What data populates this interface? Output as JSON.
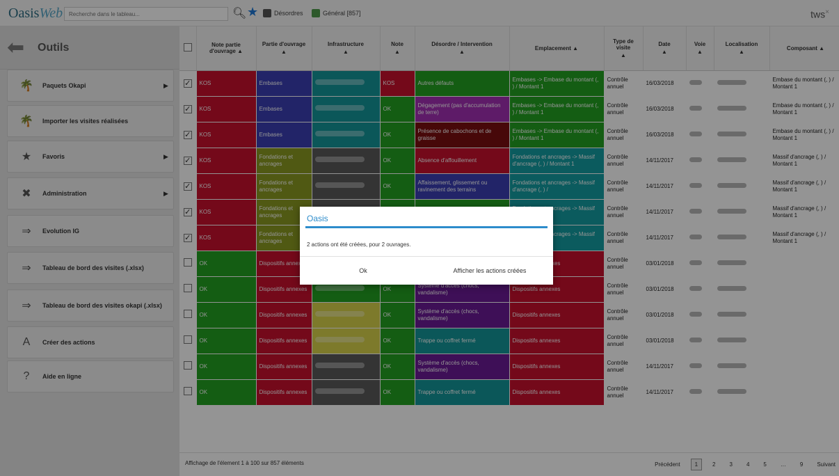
{
  "topbar": {
    "logo_main": "Oasis",
    "logo_web": "Web",
    "search_placeholder": "Recherche dans le tableau...",
    "quick_desordres": "Désordres",
    "quick_general": "Général [857]",
    "user": "tws",
    "user_close": "×"
  },
  "sidebar": {
    "title": "Outils",
    "items": [
      {
        "label": "Paquets Okapi",
        "icon": "palm-icon",
        "glyph": "🌴",
        "caret": "▶"
      },
      {
        "label": "Importer les visites réalisées",
        "icon": "palm-icon",
        "glyph": "🌴",
        "caret": ""
      },
      {
        "label": "Favoris",
        "icon": "star-icon",
        "glyph": "★",
        "caret": "▶"
      },
      {
        "label": "Administration",
        "icon": "tools-icon",
        "glyph": "✖",
        "caret": "▶"
      },
      {
        "label": "Evolution IG",
        "icon": "export-icon",
        "glyph": "⇒",
        "caret": ""
      },
      {
        "label": "Tableau de bord des visites (.xlsx)",
        "icon": "export-icon",
        "glyph": "⇒",
        "caret": ""
      },
      {
        "label": "Tableau de bord des visites okapi (.xlsx)",
        "icon": "export-icon",
        "glyph": "⇒",
        "caret": ""
      },
      {
        "label": "Créer des actions",
        "icon": "action-icon",
        "glyph": "A",
        "caret": ""
      },
      {
        "label": "Aide en ligne",
        "icon": "help-icon",
        "glyph": "?",
        "caret": ""
      }
    ]
  },
  "table": {
    "headers": [
      "Note partie d'ouvrage",
      "Partie d'ouvrage",
      "Infrastructure",
      "Note",
      "Désordre / Intervention",
      "Emplacement",
      "Type de visite",
      "Date",
      "Voie",
      "Localisation",
      "Composant"
    ],
    "colors": {
      "red": "#c8102e",
      "green": "#23a121",
      "blue": "#3b3fb3",
      "teal": "#14969a",
      "gray": "#5b5b5b",
      "olive": "#8a9a22",
      "magenta": "#a22fb3",
      "darkred": "#7a0e10",
      "purple": "#6b1b96",
      "cyan": "#149ea3",
      "yellow": "#d7d34a",
      "dred": "#c8102e"
    },
    "rows": [
      {
        "checked": true,
        "note_partie": "KOS",
        "np_color": "red",
        "partie": "Embases",
        "p_color": "blue",
        "infra_color": "teal",
        "note": "KOS",
        "n_color": "red",
        "desordre": "Autres défauts",
        "d_color": "green",
        "emplacement": "Embases -> Embase du montant (, ) / Montant 1",
        "e_color": "green",
        "type": "Contrôle annuel",
        "date": "16/03/2018",
        "composant": "Embase du montant (, ) / Montant 1"
      },
      {
        "checked": true,
        "note_partie": "KOS",
        "np_color": "red",
        "partie": "Embases",
        "p_color": "blue",
        "infra_color": "teal",
        "note": "OK",
        "n_color": "green",
        "desordre": "Dégagement (pas d'accumulation de terre)",
        "d_color": "magenta",
        "emplacement": "Embases -> Embase du montant (, ) / Montant 1",
        "e_color": "green",
        "type": "Contrôle annuel",
        "date": "16/03/2018",
        "composant": "Embase du montant (, ) / Montant 1"
      },
      {
        "checked": true,
        "note_partie": "KOS",
        "np_color": "red",
        "partie": "Embases",
        "p_color": "blue",
        "infra_color": "teal",
        "note": "OK",
        "n_color": "green",
        "desordre": "Présence de cabochons et de graisse",
        "d_color": "darkred",
        "emplacement": "Embases -> Embase du montant (, ) / Montant 1",
        "e_color": "green",
        "type": "Contrôle annuel",
        "date": "16/03/2018",
        "composant": "Embase du montant (, ) / Montant 1"
      },
      {
        "checked": true,
        "note_partie": "KOS",
        "np_color": "red",
        "partie": "Fondations et ancrages",
        "p_color": "olive",
        "infra_color": "gray",
        "note": "OK",
        "n_color": "green",
        "desordre": "Absence d'affouillement",
        "d_color": "dred",
        "emplacement": "Fondations et ancrages -> Massif d'ancrage (, ) / Montant 1",
        "e_color": "cyan",
        "type": "Contrôle annuel",
        "date": "14/11/2017",
        "composant": "Massif d'ancrage (, ) / Montant 1"
      },
      {
        "checked": true,
        "note_partie": "KOS",
        "np_color": "red",
        "partie": "Fondations et ancrages",
        "p_color": "olive",
        "infra_color": "gray",
        "note": "OK",
        "n_color": "green",
        "desordre": "Affaissement, glissement ou ravinement des terrains",
        "d_color": "blue",
        "emplacement": "Fondations et ancrages -> Massif d'ancrage (, ) /",
        "e_color": "cyan",
        "type": "Contrôle annuel",
        "date": "14/11/2017",
        "composant": "Massif d'ancrage (, ) / Montant 1"
      },
      {
        "checked": true,
        "note_partie": "KOS",
        "np_color": "red",
        "partie": "Fondations et ancrages",
        "p_color": "olive",
        "infra_color": "gray",
        "note": "OK",
        "n_color": "green",
        "desordre": "",
        "d_color": "green",
        "emplacement": "Fondations et ancrages -> Massif d'ancrage (, ) /",
        "e_color": "cyan",
        "type": "Contrôle annuel",
        "date": "14/11/2017",
        "composant": "Massif d'ancrage (, ) / Montant 1"
      },
      {
        "checked": true,
        "note_partie": "KOS",
        "np_color": "red",
        "partie": "Fondations et ancrages",
        "p_color": "olive",
        "infra_color": "gray",
        "note": "OK",
        "n_color": "green",
        "desordre": "",
        "d_color": "green",
        "emplacement": "Fondations et ancrages -> Massif d'ancrage (, ) /",
        "e_color": "cyan",
        "type": "Contrôle annuel",
        "date": "14/11/2017",
        "composant": "Massif d'ancrage (, ) / Montant 1"
      },
      {
        "checked": false,
        "note_partie": "OK",
        "np_color": "green",
        "partie": "Dispositifs annexes",
        "p_color": "dred",
        "infra_color": "dred",
        "note": "OK",
        "n_color": "green",
        "desordre": "Système d'accès (chocs, vandalisme)",
        "d_color": "purple",
        "emplacement": "Dispositifs annexes",
        "e_color": "dred",
        "type": "Contrôle annuel",
        "date": "03/01/2018",
        "composant": ""
      },
      {
        "checked": false,
        "note_partie": "OK",
        "np_color": "green",
        "partie": "Dispositifs annexes",
        "p_color": "dred",
        "infra_color": "green",
        "note": "OK",
        "n_color": "green",
        "desordre": "Système d'accès (chocs, vandalisme)",
        "d_color": "purple",
        "emplacement": "Dispositifs annexes",
        "e_color": "dred",
        "type": "Contrôle annuel",
        "date": "03/01/2018",
        "composant": ""
      },
      {
        "checked": false,
        "note_partie": "OK",
        "np_color": "green",
        "partie": "Dispositifs annexes",
        "p_color": "dred",
        "infra_color": "yellow",
        "note": "OK",
        "n_color": "green",
        "desordre": "Système d'accès (chocs, vandalisme)",
        "d_color": "purple",
        "emplacement": "Dispositifs annexes",
        "e_color": "dred",
        "type": "Contrôle annuel",
        "date": "03/01/2018",
        "composant": ""
      },
      {
        "checked": false,
        "note_partie": "OK",
        "np_color": "green",
        "partie": "Dispositifs annexes",
        "p_color": "dred",
        "infra_color": "yellow",
        "note": "OK",
        "n_color": "green",
        "desordre": "Trappe ou coffret fermé",
        "d_color": "teal",
        "emplacement": "Dispositifs annexes",
        "e_color": "dred",
        "type": "Contrôle annuel",
        "date": "03/01/2018",
        "composant": ""
      },
      {
        "checked": false,
        "note_partie": "OK",
        "np_color": "green",
        "partie": "Dispositifs annexes",
        "p_color": "dred",
        "infra_color": "gray",
        "note": "OK",
        "n_color": "green",
        "desordre": "Système d'accès (chocs, vandalisme)",
        "d_color": "purple",
        "emplacement": "Dispositifs annexes",
        "e_color": "dred",
        "type": "Contrôle annuel",
        "date": "14/11/2017",
        "composant": ""
      },
      {
        "checked": false,
        "note_partie": "OK",
        "np_color": "green",
        "partie": "Dispositifs annexes",
        "p_color": "dred",
        "infra_color": "gray",
        "note": "OK",
        "n_color": "green",
        "desordre": "Trappe ou coffret fermé",
        "d_color": "teal",
        "emplacement": "Dispositifs annexes",
        "e_color": "dred",
        "type": "Contrôle annuel",
        "date": "14/11/2017",
        "composant": ""
      }
    ]
  },
  "footer": {
    "info": "Affichage de l'élement 1 à 100 sur 857 éléments",
    "pages": [
      "Précédent",
      "1",
      "2",
      "3",
      "4",
      "5",
      "…",
      "9",
      "Suivant"
    ],
    "current": "1"
  },
  "modal": {
    "title": "Oasis",
    "message": "2 actions ont été créées, pour 2 ouvrages.",
    "ok": "Ok",
    "show_actions": "Afficher les actions créées"
  }
}
